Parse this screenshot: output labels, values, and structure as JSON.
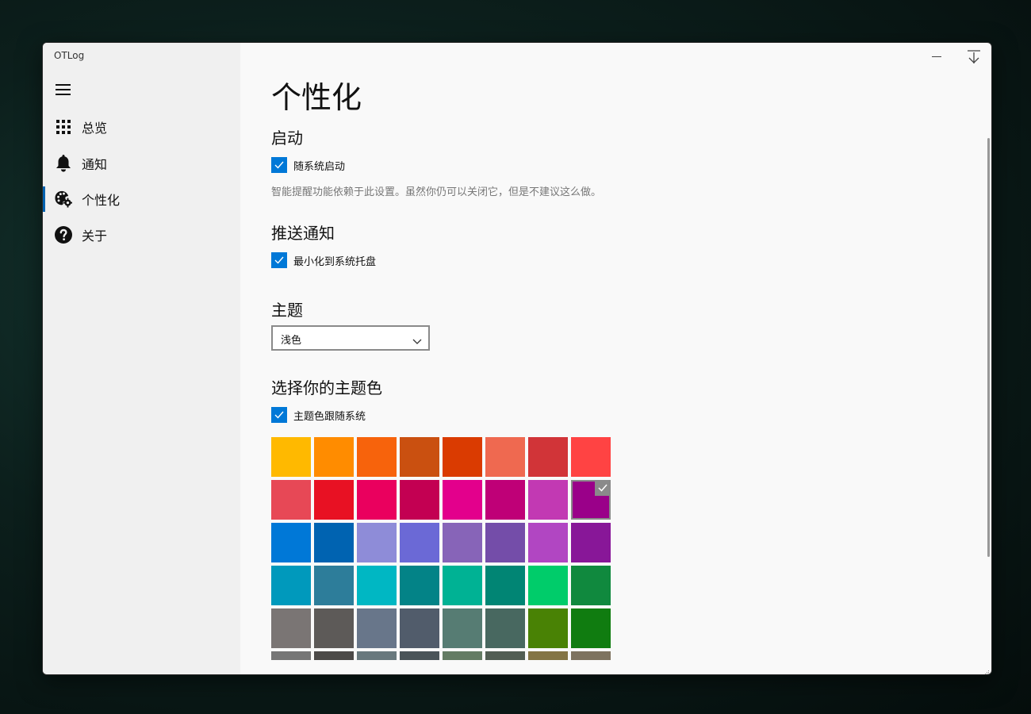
{
  "app": {
    "title": "OTLog"
  },
  "sidebar": {
    "items": [
      {
        "label": "总览",
        "icon": "apps-grid-icon"
      },
      {
        "label": "通知",
        "icon": "bell-icon"
      },
      {
        "label": "个性化",
        "icon": "palette-icon",
        "active": true
      },
      {
        "label": "关于",
        "icon": "help-icon"
      }
    ]
  },
  "page": {
    "title": "个性化",
    "startup": {
      "heading": "启动",
      "checkbox_label": "随系统启动",
      "checked": true,
      "note": "智能提醒功能依赖于此设置。虽然你仍可以关闭它，但是不建议这么做。"
    },
    "push": {
      "heading": "推送通知",
      "checkbox_label": "最小化到系统托盘",
      "checked": true
    },
    "theme": {
      "heading": "主题",
      "selected": "浅色"
    },
    "accent": {
      "heading": "选择你的主题色",
      "checkbox_label": "主题色跟随系统",
      "checked": true,
      "selected_index": 15,
      "colors": [
        "#FFB900",
        "#FF8C00",
        "#F7630C",
        "#CA5010",
        "#DA3B01",
        "#EF6950",
        "#D13438",
        "#FF4343",
        "#E74856",
        "#E81123",
        "#EA005E",
        "#C30052",
        "#E3008C",
        "#BF0077",
        "#C239B3",
        "#9A0089",
        "#0078D7",
        "#0063B1",
        "#8E8CD8",
        "#6B69D6",
        "#8764B8",
        "#744DA9",
        "#B146C2",
        "#881798",
        "#0099BC",
        "#2D7D9A",
        "#00B7C3",
        "#038387",
        "#00B294",
        "#018574",
        "#00CC6A",
        "#10893E",
        "#7A7574",
        "#5D5A58",
        "#68768A",
        "#515C6B",
        "#567C73",
        "#486860",
        "#498205",
        "#107C10",
        "#767676",
        "#4C4A48",
        "#69797E",
        "#4A5459",
        "#647C64",
        "#525E54",
        "#847545",
        "#7E735F"
      ]
    }
  }
}
